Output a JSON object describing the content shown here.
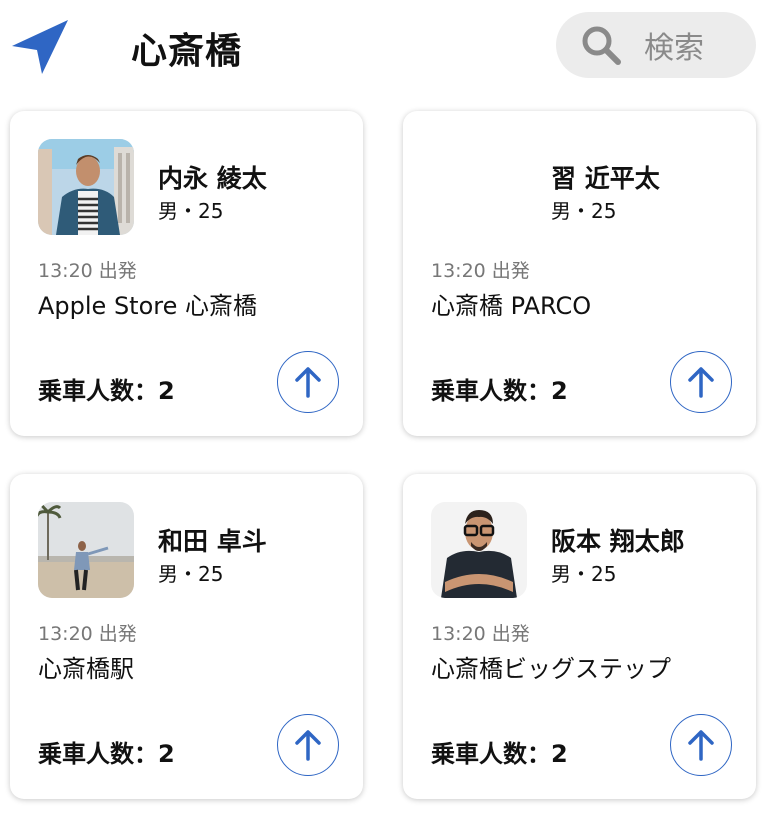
{
  "header": {
    "title": "心斎橋",
    "search_label": "検索"
  },
  "cards": [
    {
      "name": "内永 綾太",
      "meta": "男・25",
      "time": "13:20 出発",
      "place": "Apple Store 心斎橋",
      "passengers": "乗車人数：2"
    },
    {
      "name": "習 近平太",
      "meta": "男・25",
      "time": "13:20 出発",
      "place": "心斎橋 PARCO",
      "passengers": "乗車人数：2"
    },
    {
      "name": "和田 卓斗",
      "meta": "男・25",
      "time": "13:20 出発",
      "place": "心斎橋駅",
      "passengers": "乗車人数：2"
    },
    {
      "name": "阪本 翔太郎",
      "meta": "男・25",
      "time": "13:20 出発",
      "place": "心斎橋ビッグステップ",
      "passengers": "乗車人数：2"
    }
  ],
  "colors": {
    "accent": "#2f66c4",
    "search_bg": "#ececec"
  },
  "icons": {
    "nav": "location-arrow-icon",
    "search": "search-icon",
    "up": "arrow-up-icon"
  }
}
